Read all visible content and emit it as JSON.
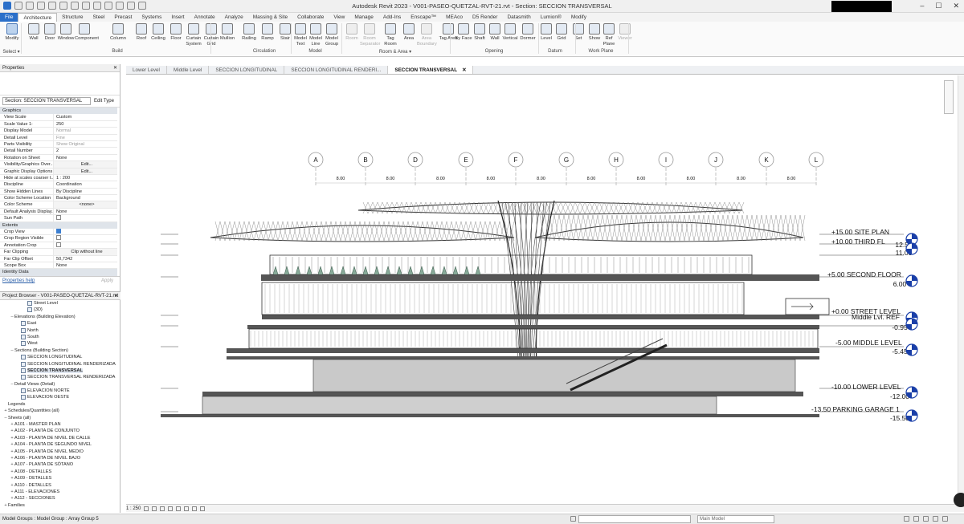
{
  "titlebar": {
    "title": "Autodesk Revit 2023 - V001-PASEO-QUETZAL-RVT-21.rvt - Section: SECCION TRANSVERSAL"
  },
  "ribbon_tabs": [
    "File",
    "Architecture",
    "Structure",
    "Steel",
    "Precast",
    "Systems",
    "Insert",
    "Annotate",
    "Analyze",
    "Massing & Site",
    "Collaborate",
    "View",
    "Manage",
    "Add-Ins",
    "Enscape™",
    "MEAco",
    "D5 Render",
    "Datasmith",
    "Lumion®",
    "Modify"
  ],
  "ribbon_buttons": [
    {
      "label": "Modify",
      "state": "sel"
    },
    {
      "label": "Wall"
    },
    {
      "label": "Door"
    },
    {
      "label": "Window"
    },
    {
      "label": "Component"
    },
    {
      "label": "Column"
    },
    {
      "label": "Roof"
    },
    {
      "label": "Ceiling"
    },
    {
      "label": "Floor"
    },
    {
      "label": "Curtain System"
    },
    {
      "label": "Curtain Grid"
    },
    {
      "label": "Mullion"
    },
    {
      "label": "Railing"
    },
    {
      "label": "Ramp"
    },
    {
      "label": "Stair"
    },
    {
      "label": "Model Text"
    },
    {
      "label": "Model Line"
    },
    {
      "label": "Model Group"
    },
    {
      "label": "Room",
      "state": "dis"
    },
    {
      "label": "Room Separator",
      "state": "dis"
    },
    {
      "label": "Tag Room"
    },
    {
      "label": "Area"
    },
    {
      "label": "Area Boundary",
      "state": "dis"
    },
    {
      "label": "Tag Area"
    },
    {
      "label": "By Face"
    },
    {
      "label": "Shaft"
    },
    {
      "label": "Wall"
    },
    {
      "label": "Vertical"
    },
    {
      "label": "Dormer"
    },
    {
      "label": "Level"
    },
    {
      "label": "Grid"
    },
    {
      "label": "Set"
    },
    {
      "label": "Show"
    },
    {
      "label": "Ref Plane"
    },
    {
      "label": "Viewer",
      "state": "dis"
    }
  ],
  "ribbon_panels": [
    "Select ▾",
    "Build",
    "Circulation",
    "Model",
    "Room & Area ▾",
    "Opening",
    "Datum",
    "Work Plane"
  ],
  "properties": {
    "header": "Properties",
    "type_selector": "Section: SECCION TRANSVERSAL",
    "edit_type": "Edit Type",
    "help": "Properties help",
    "apply": "Apply",
    "groups": [
      {
        "name": "Graphics",
        "rows": [
          [
            "View Scale",
            "Custom",
            ""
          ],
          [
            "Scale Value    1:",
            "250",
            ""
          ],
          [
            "Display Model",
            "Normal",
            "g"
          ],
          [
            "Detail Level",
            "Fine",
            "g"
          ],
          [
            "Parts Visibility",
            "Show Original",
            "g"
          ],
          [
            "Detail Number",
            "2",
            ""
          ],
          [
            "Rotation on Sheet",
            "None",
            ""
          ],
          [
            "Visibility/Graphics Over...",
            "Edit...",
            "btn"
          ],
          [
            "Graphic Display Options",
            "Edit...",
            "btn"
          ],
          [
            "Hide at scales coarser t...",
            "1 : 200",
            ""
          ],
          [
            "Discipline",
            "Coordination",
            ""
          ],
          [
            "Show Hidden Lines",
            "By Discipline",
            ""
          ],
          [
            "Color Scheme Location",
            "Background",
            ""
          ],
          [
            "Color Scheme",
            "<none>",
            "btn"
          ],
          [
            "Default Analysis Display...",
            "None",
            ""
          ],
          [
            "Sun Path",
            "",
            ""
          ]
        ]
      },
      {
        "name": "Extents",
        "rows": [
          [
            "Crop View",
            "",
            "on"
          ],
          [
            "Crop Region Visible",
            "",
            "off"
          ],
          [
            "Annotation Crop",
            "",
            "off"
          ],
          [
            "Far Clipping",
            "Clip without line",
            "btn"
          ],
          [
            "Far Clip Offset",
            "50,7342",
            ""
          ],
          [
            "Scope Box",
            "None",
            ""
          ]
        ]
      },
      {
        "name": "Identity Data",
        "rows": []
      }
    ]
  },
  "project_browser": {
    "header": "Project Browser - V001-PASEO-QUETZAL-RVT-21.rvt",
    "items": [
      {
        "indent": 3,
        "label": "Street Level",
        "toggle": ""
      },
      {
        "indent": 3,
        "label": "{3D}",
        "toggle": ""
      },
      {
        "indent": 1,
        "label": "Elevations (Building Elevation)",
        "toggle": "–"
      },
      {
        "indent": 2,
        "label": "East",
        "toggle": ""
      },
      {
        "indent": 2,
        "label": "North",
        "toggle": ""
      },
      {
        "indent": 2,
        "label": "South",
        "toggle": ""
      },
      {
        "indent": 2,
        "label": "West",
        "toggle": ""
      },
      {
        "indent": 1,
        "label": "Sections (Building Section)",
        "toggle": "–"
      },
      {
        "indent": 2,
        "label": "SECCION LONGITUDINAL",
        "toggle": ""
      },
      {
        "indent": 2,
        "label": "SECCION LONGITUDINAL RENDERIZADA",
        "toggle": ""
      },
      {
        "indent": 2,
        "label": "SECCION TRANSVERSAL",
        "toggle": "",
        "selected": true
      },
      {
        "indent": 2,
        "label": "SECCION TRANSVERSAL RENDERIZADA",
        "toggle": ""
      },
      {
        "indent": 1,
        "label": "Detail Views (Detail)",
        "toggle": "–"
      },
      {
        "indent": 2,
        "label": "ELEVACION NORTE",
        "toggle": ""
      },
      {
        "indent": 2,
        "label": "ELEVACION OESTE",
        "toggle": ""
      },
      {
        "indent": 0,
        "label": "Legends",
        "toggle": ""
      },
      {
        "indent": 0,
        "label": "Schedules/Quantities (all)",
        "toggle": "+"
      },
      {
        "indent": 0,
        "label": "Sheets (all)",
        "toggle": "–"
      },
      {
        "indent": 1,
        "label": "A101 - MASTER PLAN",
        "toggle": "+"
      },
      {
        "indent": 1,
        "label": "A102 - PLANTA DE CONJUNTO",
        "toggle": "+"
      },
      {
        "indent": 1,
        "label": "A103 - PLANTA DE NIVEL DE CALLE",
        "toggle": "+"
      },
      {
        "indent": 1,
        "label": "A104 - PLANTA DE SEGUNDO NIVEL",
        "toggle": "+"
      },
      {
        "indent": 1,
        "label": "A105 - PLANTA DE NIVEL MEDIO",
        "toggle": "+"
      },
      {
        "indent": 1,
        "label": "A106 - PLANTA DE NIVEL BAJO",
        "toggle": "+"
      },
      {
        "indent": 1,
        "label": "A107 - PLANTA DE SÓTANO",
        "toggle": "+"
      },
      {
        "indent": 1,
        "label": "A108 - DETALLES",
        "toggle": "+"
      },
      {
        "indent": 1,
        "label": "A109 - DETALLES",
        "toggle": "+"
      },
      {
        "indent": 1,
        "label": "A110 - DETALLES",
        "toggle": "+"
      },
      {
        "indent": 1,
        "label": "A111 - ELEVACIONES",
        "toggle": "+"
      },
      {
        "indent": 1,
        "label": "A112 - SECCIONES",
        "toggle": "+"
      },
      {
        "indent": 0,
        "label": "Families",
        "toggle": "+"
      }
    ]
  },
  "view_tabs": [
    {
      "label": "Lower Level",
      "active": false
    },
    {
      "label": "Middle Level",
      "active": false
    },
    {
      "label": "SECCION LONGITUDINAL",
      "active": false
    },
    {
      "label": "SECCION LONGITUDINAL RENDERI...",
      "active": false
    },
    {
      "label": "SECCION TRANSVERSAL",
      "active": true
    }
  ],
  "drawing": {
    "grids": [
      "A",
      "B",
      "D",
      "E",
      "F",
      "G",
      "H",
      "I",
      "J",
      "K",
      "L"
    ],
    "dims": [
      "8.00",
      "8.00",
      "8.00",
      "8.00",
      "8.00",
      "8.00",
      "8.00",
      "8.00",
      "8.00",
      "8.00"
    ],
    "levels": [
      {
        "name": "+15.00 SITE PLAN",
        "value": ""
      },
      {
        "name": "+10.00 THIRD FL",
        "value": "12.50"
      },
      {
        "name": "",
        "value": "11.00"
      },
      {
        "name": "+5.00 SECOND FLOOR",
        "value": "6.00"
      },
      {
        "name": "+0.00 STREET LEVEL",
        "value": ""
      },
      {
        "name": "Middle Lvl. REF",
        "value": "-0.95"
      },
      {
        "name": "-5.00 MIDDLE LEVEL",
        "value": "-5.45"
      },
      {
        "name": "-10.00 LOWER LEVEL",
        "value": "-12.00"
      },
      {
        "name": "-13.50 PARKING GARAGE 1",
        "value": "-15.50"
      }
    ]
  },
  "view_control": {
    "scale": "1 : 250"
  },
  "status": {
    "text": "Model Groups : Model Group : Array Group 5",
    "workset": "Main Model"
  }
}
